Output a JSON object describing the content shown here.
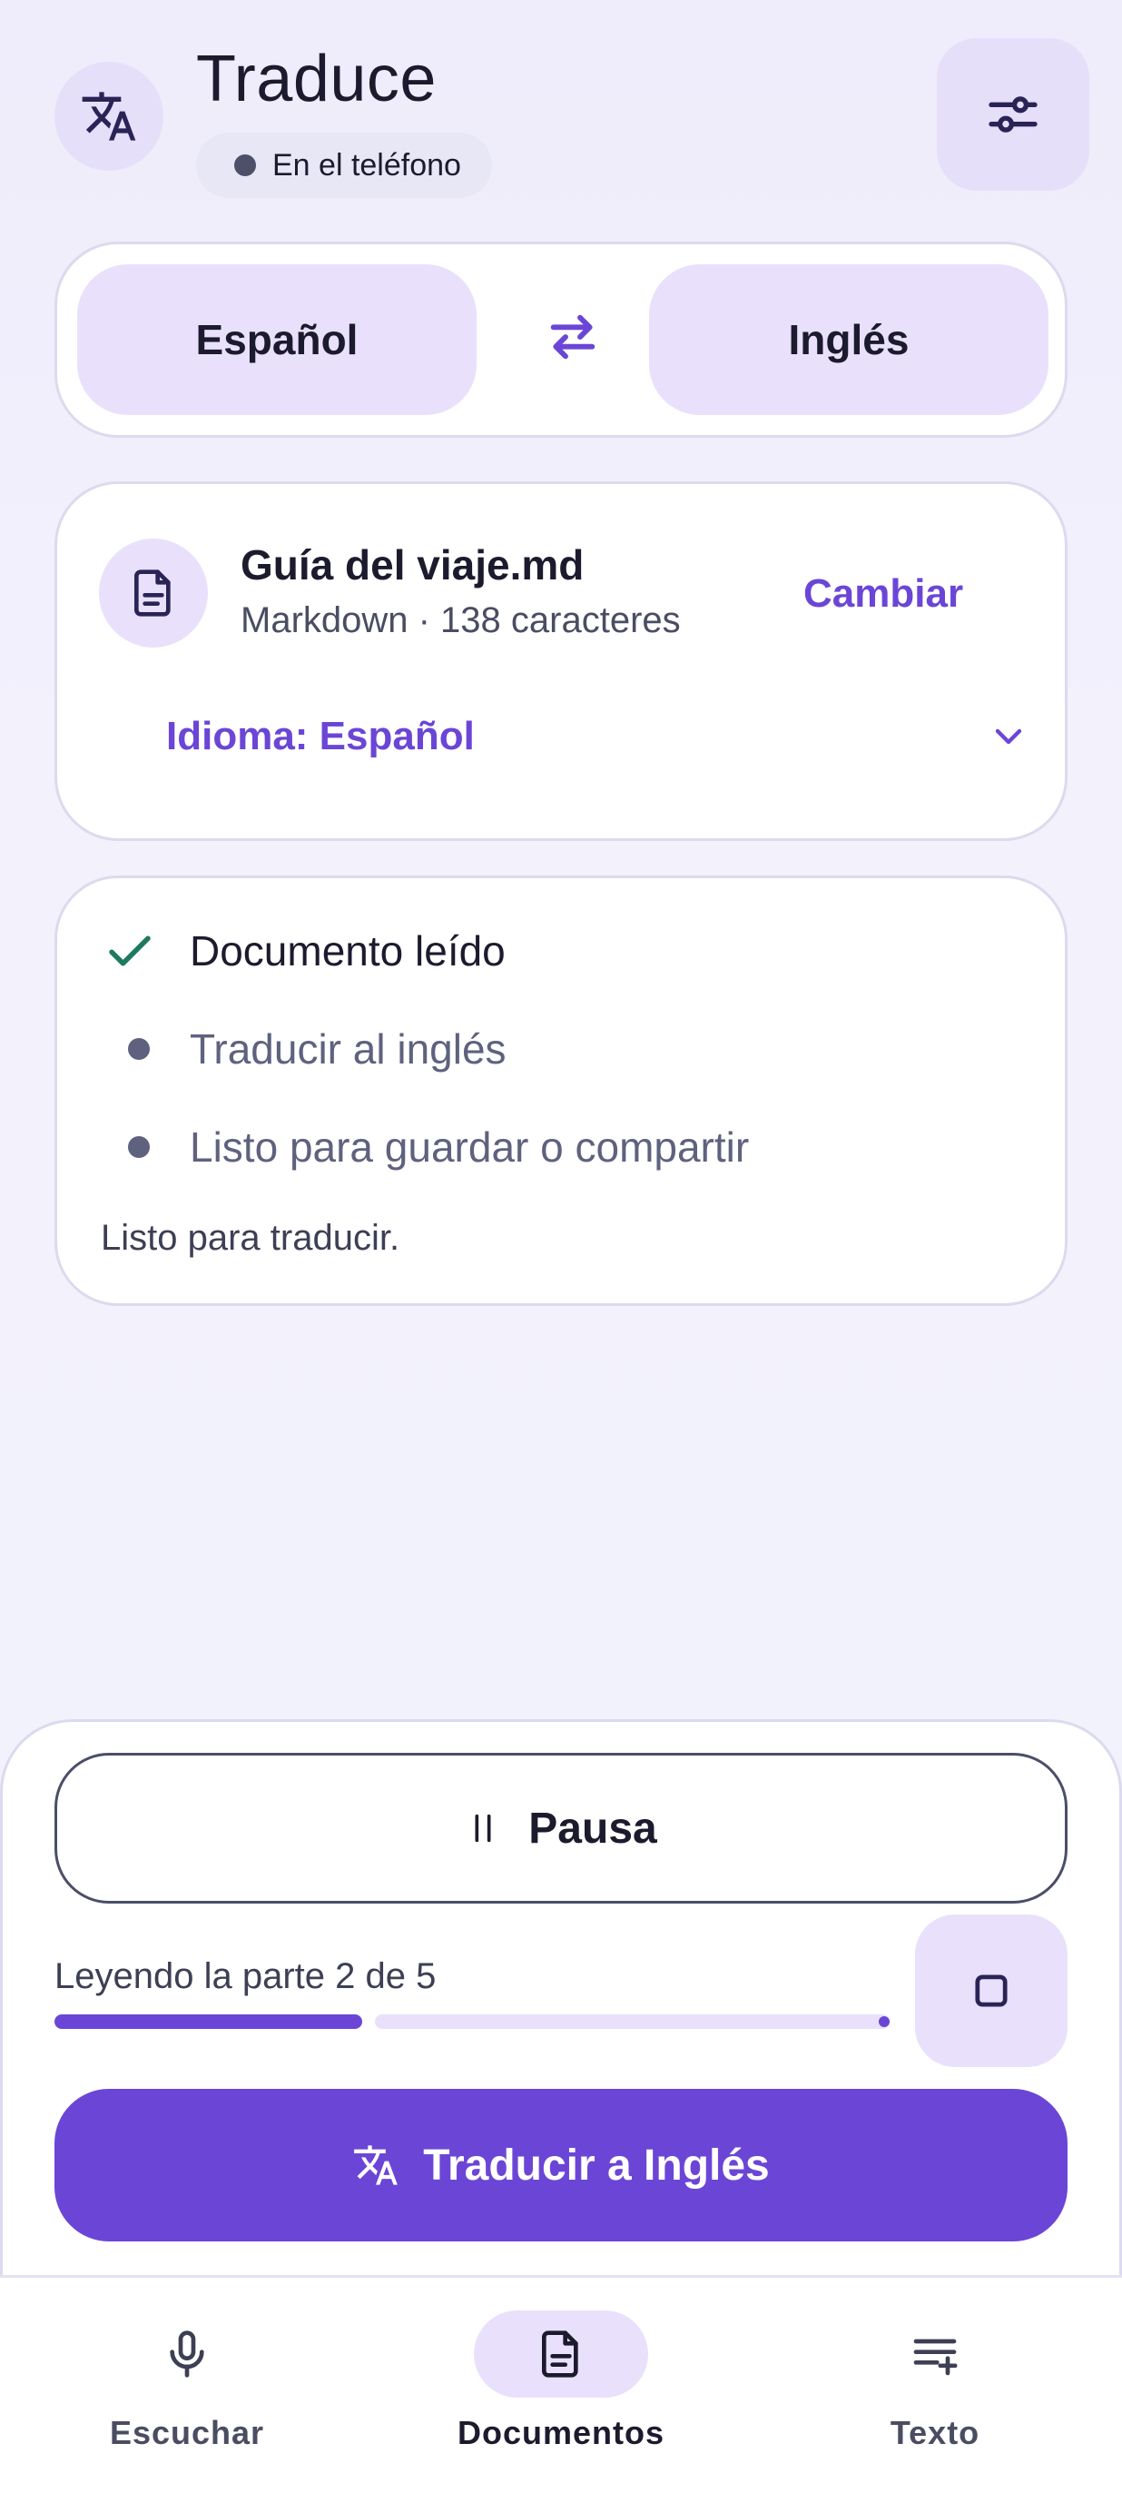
{
  "header": {
    "title": "Traduce",
    "status": "En el teléfono"
  },
  "languages": {
    "source": "Español",
    "target": "Inglés"
  },
  "document": {
    "name": "Guía del viaje.md",
    "meta": "Markdown · 138 caracteres",
    "change_label": "Cambiar",
    "language_label": "Idioma: Español"
  },
  "steps": {
    "items": [
      {
        "label": "Documento leído",
        "state": "done"
      },
      {
        "label": "Traducir al inglés",
        "state": "pending"
      },
      {
        "label": "Listo para guardar o compartir",
        "state": "pending"
      }
    ],
    "status": "Listo para traducir."
  },
  "playback": {
    "pause_label": "Pausa",
    "progress_label": "Leyendo la parte 2 de 5",
    "part_current": 2,
    "part_total": 5
  },
  "translate_button": "Traducir a Inglés",
  "nav": {
    "items": [
      {
        "label": "Escuchar",
        "icon": "mic-icon",
        "active": false
      },
      {
        "label": "Documentos",
        "icon": "document-icon",
        "active": true
      },
      {
        "label": "Texto",
        "icon": "text-add-icon",
        "active": false
      }
    ]
  },
  "colors": {
    "accent": "#6B46D6",
    "accent_container": "#E9E1FB",
    "success": "#1E7A5E"
  }
}
